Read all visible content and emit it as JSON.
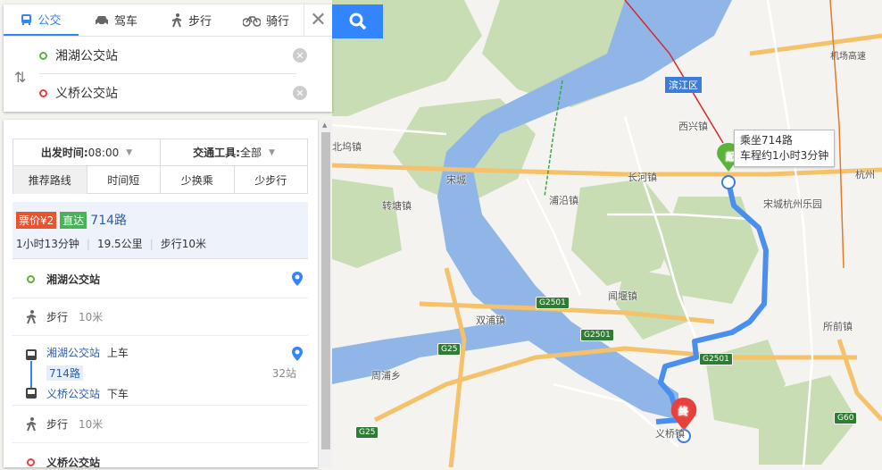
{
  "tabs": [
    {
      "label": "公交",
      "icon": "bus-icon"
    },
    {
      "label": "驾车",
      "icon": "car-icon"
    },
    {
      "label": "步行",
      "icon": "walk-icon"
    },
    {
      "label": "骑行",
      "icon": "bike-icon"
    }
  ],
  "route_inputs": {
    "start": "湘湖公交站",
    "end": "义桥公交站"
  },
  "filters": {
    "depart_label": "出发时间:",
    "depart_value": "08:00",
    "transport_label": "交通工具:",
    "transport_value": "全部",
    "options": [
      "推荐路线",
      "时间短",
      "少换乘",
      "少步行"
    ]
  },
  "route": {
    "fare_tag": "票价¥2",
    "direct_tag": "直达",
    "line_name": "714路",
    "duration": "1小时13分钟",
    "distance": "19.5公里",
    "walk": "步行10米"
  },
  "steps": {
    "start_stop": "湘湖公交站",
    "walk1_label": "步行",
    "walk1_dist": "10米",
    "board_stop": "湘湖公交站",
    "board_action": "上车",
    "bus_line": "714路",
    "stop_count": "32站",
    "alight_stop": "义桥公交站",
    "alight_action": "下车",
    "walk2_label": "步行",
    "walk2_dist": "10米",
    "end_stop": "义桥公交站"
  },
  "map": {
    "callout_line1": "乘坐714路",
    "callout_line2": "车程约1小时3分钟",
    "start_marker": "起",
    "end_marker": "终",
    "district": "滨江区",
    "highway_label": "机场高速",
    "labels": [
      "北坞镇",
      "宋城",
      "转塘镇",
      "浦沿镇",
      "长河镇",
      "西兴镇",
      "宋城杭州乐园",
      "闻堰镇",
      "双浦镇",
      "周浦乡",
      "所前镇",
      "义桥镇",
      "杭州"
    ],
    "road_shields": [
      "G2501",
      "G2501",
      "G2501",
      "G25",
      "G25",
      "G60"
    ],
    "colors": {
      "route": "#4a8ff0",
      "river": "#8fb6e6",
      "highway": "#f5c26b",
      "accent": "#3385ff"
    }
  }
}
